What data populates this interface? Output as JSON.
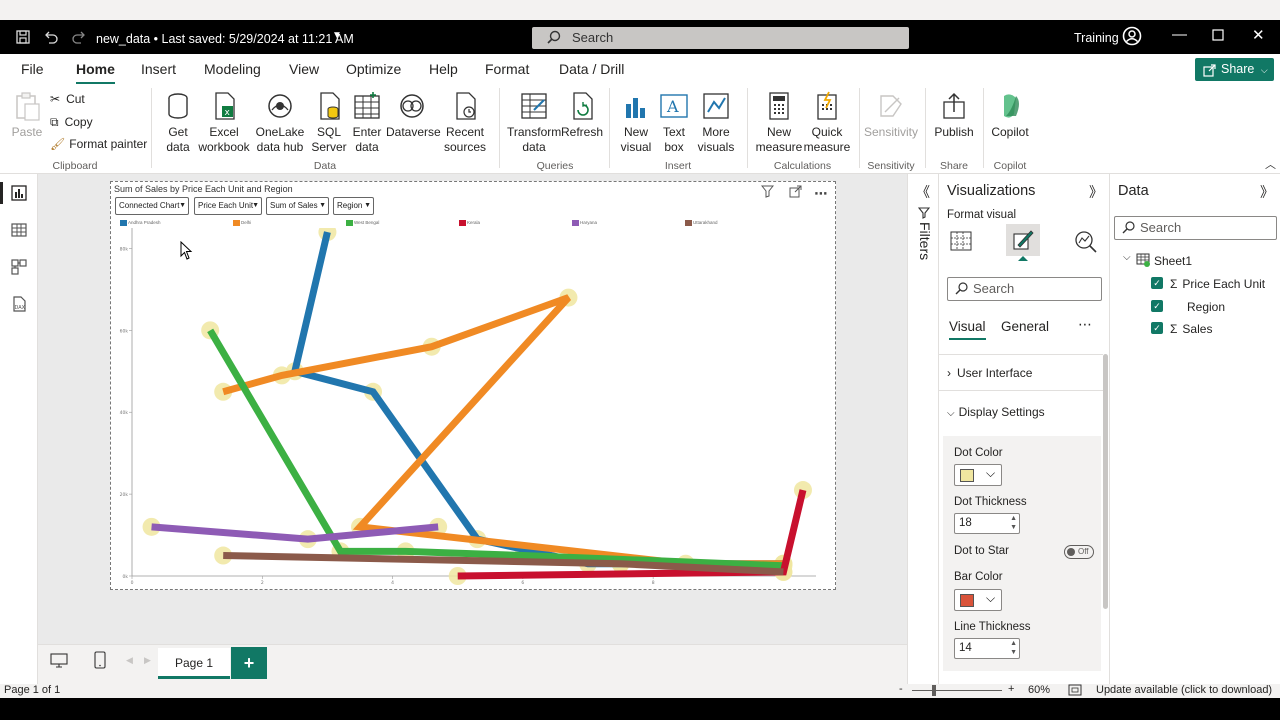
{
  "titlebar": {
    "doc_title": "new_data • Last saved: 5/29/2024 at 11:21 AM",
    "search_placeholder": "Search",
    "user": "Training"
  },
  "tabs": [
    {
      "label": "File"
    },
    {
      "label": "Home",
      "active": true
    },
    {
      "label": "Insert"
    },
    {
      "label": "Modeling"
    },
    {
      "label": "View"
    },
    {
      "label": "Optimize"
    },
    {
      "label": "Help"
    },
    {
      "label": "Format"
    },
    {
      "label": "Data / Drill"
    }
  ],
  "share_label": "Share",
  "ribbon": {
    "paste": "Paste",
    "cut": "Cut",
    "copy": "Copy",
    "format_painter": "Format painter",
    "clipboard_group": "Clipboard",
    "get_data": "Get data",
    "excel": "Excel workbook",
    "onelake": "OneLake data hub",
    "sql": "SQL Server",
    "enter_data": "Enter data",
    "dataverse": "Dataverse",
    "recent": "Recent sources",
    "data_group": "Data",
    "transform": "Transform data",
    "refresh": "Refresh",
    "queries_group": "Queries",
    "new_visual": "New visual",
    "text_box": "Text box",
    "more_visuals": "More visuals",
    "insert_group": "Insert",
    "new_measure": "New measure",
    "quick_measure": "Quick measure",
    "calculations_group": "Calculations",
    "sensitivity": "Sensitivity",
    "sensitivity_group": "Sensitivity",
    "publish": "Publish",
    "share_group": "Share",
    "copilot": "Copilot",
    "copilot_group": "Copilot"
  },
  "visual": {
    "title": "Sum of Sales by Price Each Unit and Region",
    "dropdowns": [
      "Connected Chart",
      "Price Each Unit",
      "Sum of Sales",
      "Region"
    ]
  },
  "chart_data": {
    "type": "line",
    "title": "Sum of Sales by Price Each Unit and Region",
    "xlim": [
      0,
      10.5
    ],
    "ylim": [
      0,
      85000
    ],
    "x_ticks": [
      "0",
      "2",
      "4",
      "6",
      "8"
    ],
    "y_ticks": [
      "0k",
      "20k",
      "40k",
      "60k",
      "80k"
    ],
    "dot_color": "#f0e6a0",
    "series": [
      {
        "name": "Andhra Pradesh",
        "color": "#2176ae",
        "x": [
          3.0,
          2.5,
          3.7,
          5.3,
          7.0,
          7.5,
          10.0
        ],
        "y": [
          84000,
          50000,
          45000,
          9000,
          3000,
          3000,
          3000
        ]
      },
      {
        "name": "Delhi",
        "color": "#f08a24",
        "x": [
          1.4,
          2.3,
          4.6,
          6.7,
          3.5,
          8.5,
          10.0
        ],
        "y": [
          45000,
          49000,
          56000,
          68000,
          12000,
          3000,
          3000
        ]
      },
      {
        "name": "West Bengal",
        "color": "#3cb043",
        "x": [
          1.2,
          3.2,
          4.2,
          6.0,
          10.0
        ],
        "y": [
          60000,
          6000,
          6000,
          5000,
          2500
        ]
      },
      {
        "name": "Kerala",
        "color": "#c8102e",
        "x": [
          5.0,
          10.0,
          10.3
        ],
        "y": [
          0,
          1000,
          21000
        ]
      },
      {
        "name": "Haryana",
        "color": "#8e5bb5",
        "x": [
          0.3,
          2.7,
          4.7
        ],
        "y": [
          12000,
          9000,
          12000
        ]
      },
      {
        "name": "Uttarakhand",
        "color": "#8b5a4a",
        "x": [
          1.4,
          7.5,
          10.0
        ],
        "y": [
          5000,
          3000,
          1000
        ]
      }
    ]
  },
  "filters_label": "Filters",
  "vizpane": {
    "title": "Visualizations",
    "format_visual": "Format visual",
    "search": "Search",
    "tab_visual": "Visual",
    "tab_general": "General",
    "user_interface": "User Interface",
    "display_settings": "Display Settings",
    "dot_color_label": "Dot Color",
    "dot_color": "#f0e6a0",
    "dot_thickness_label": "Dot Thickness",
    "dot_thickness": "18",
    "dot_to_star_label": "Dot to Star",
    "dot_to_star": "Off",
    "bar_color_label": "Bar Color",
    "bar_color": "#d9533a",
    "line_thickness_label": "Line Thickness",
    "line_thickness": "14"
  },
  "datapane": {
    "title": "Data",
    "search": "Search",
    "table": "Sheet1",
    "fields": [
      "Price Each Unit",
      "Region",
      "Sales"
    ]
  },
  "pagebar": {
    "page": "Page 1"
  },
  "status": {
    "page_of": "Page 1 of 1",
    "zoom": "60%",
    "update": "Update available (click to download)"
  }
}
